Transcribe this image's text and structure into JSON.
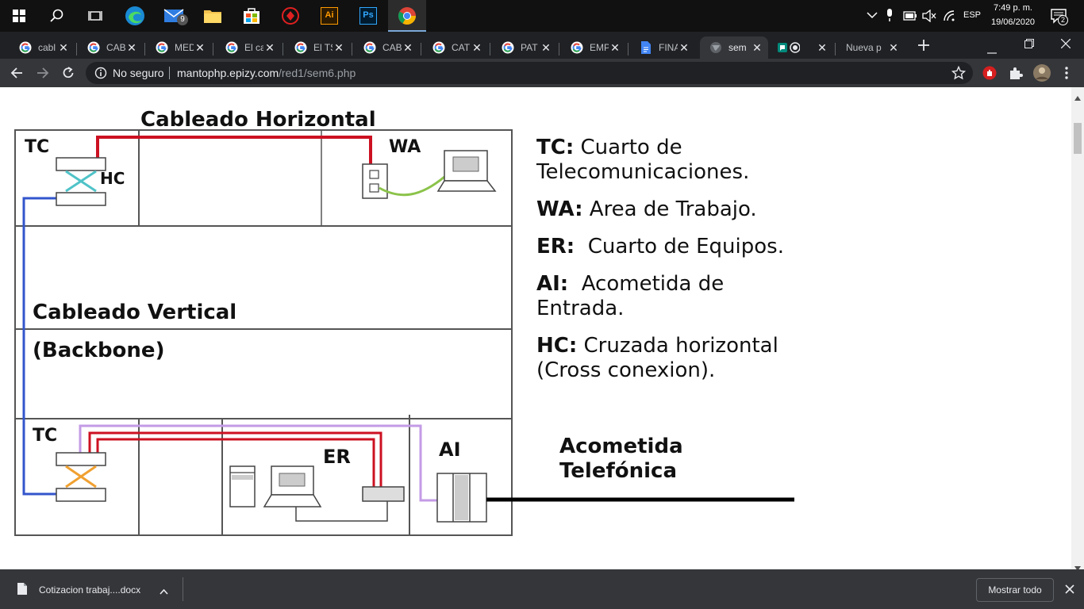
{
  "taskbar": {
    "mail_badge": "9",
    "tray": {
      "language": "ESP",
      "time": "7:49 p. m.",
      "date": "19/06/2020",
      "notification_count": "2"
    }
  },
  "tabs": [
    {
      "label": "cabl",
      "icon": "google-icon"
    },
    {
      "label": "CAB",
      "icon": "google-icon"
    },
    {
      "label": "MED",
      "icon": "google-icon"
    },
    {
      "label": "El ca",
      "icon": "google-icon"
    },
    {
      "label": "El TS",
      "icon": "google-icon"
    },
    {
      "label": "CAB",
      "icon": "google-icon"
    },
    {
      "label": "CAT",
      "icon": "google-icon"
    },
    {
      "label": "PAT",
      "icon": "google-icon"
    },
    {
      "label": "EMP",
      "icon": "google-icon"
    },
    {
      "label": "FINA",
      "icon": "docs-icon"
    },
    {
      "label": "sem",
      "icon": "globe-icon",
      "active": true
    },
    {
      "label": "",
      "icon": "meet-icon"
    },
    {
      "label": "Nueva p",
      "icon": "none"
    }
  ],
  "omnibox": {
    "security": "No seguro",
    "url_host": "mantophp.epizy.com",
    "url_path": "/red1/sem6.php"
  },
  "diagram": {
    "title_horizontal": "Cableado Horizontal",
    "title_vertical": "Cableado Vertical",
    "title_backbone": "(Backbone)",
    "label_tc_top": "TC",
    "label_hc": "HC",
    "label_wa": "WA",
    "label_tc_bottom": "TC",
    "label_er": "ER",
    "label_ai": "AI",
    "acometida_1": "Acometida",
    "acometida_2": "Telefónica",
    "colors": {
      "horizontal": "#cc1122",
      "vertical": "#3355cc",
      "patch": "#8bc34a",
      "cross": "#4fc3c8",
      "cross_bottom": "#f0a030",
      "purple": "#c39be6",
      "line": "#555555"
    }
  },
  "legend": [
    {
      "key": "TC:",
      "text_1": " Cuarto de",
      "text_2": "Telecomunicaciones."
    },
    {
      "key": "WA:",
      "text_1": " Area de Trabajo.",
      "text_2": ""
    },
    {
      "key": "ER:",
      "text_1": "  Cuarto de Equipos.",
      "text_2": ""
    },
    {
      "key": "AI:",
      "text_1": "  Acometida de",
      "text_2": "Entrada."
    },
    {
      "key": "HC:",
      "text_1": " Cruzada horizontal",
      "text_2": "(Cross conexion)."
    }
  ],
  "download": {
    "filename": "Cotizacion trabaj....docx",
    "show_all": "Mostrar todo"
  }
}
